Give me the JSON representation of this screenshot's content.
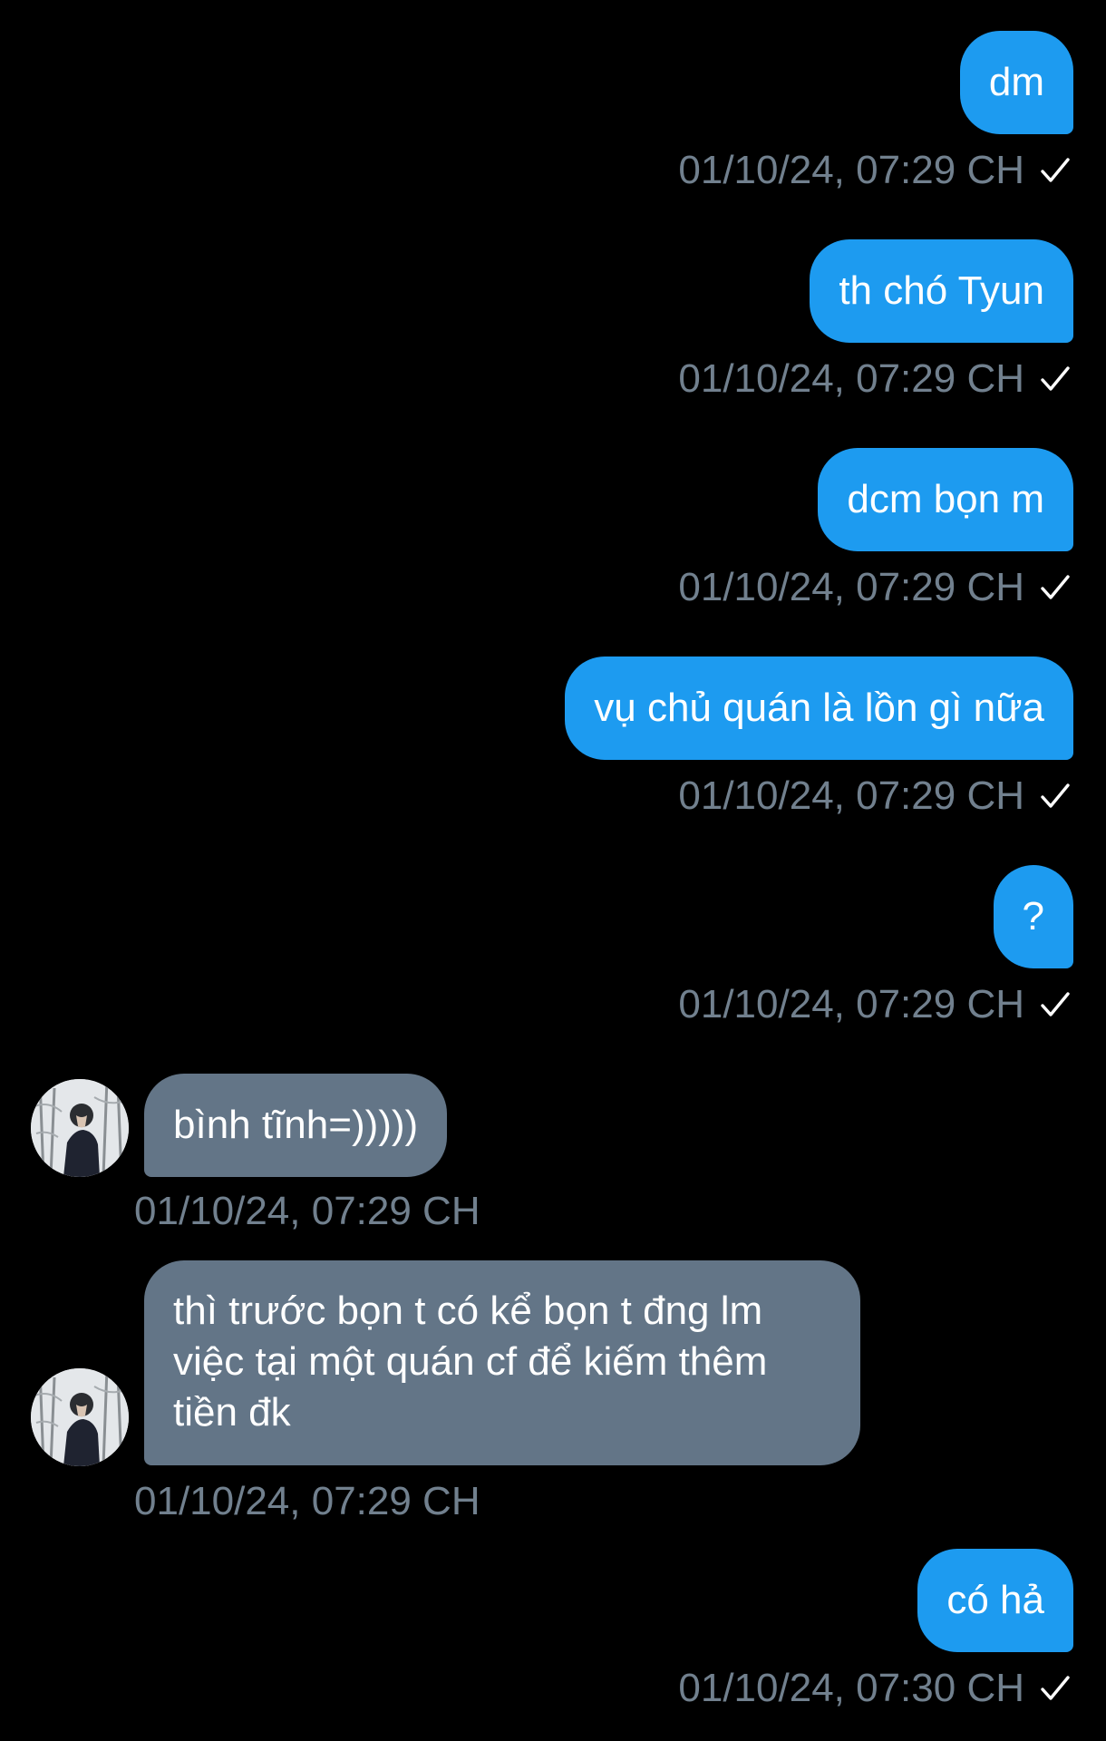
{
  "conversation": {
    "messages": [
      {
        "direction": "outgoing",
        "text": "dm",
        "timestamp": "01/10/24, 07:29 CH",
        "read_receipt": "check-icon"
      },
      {
        "direction": "outgoing",
        "text": "th chó Tyun",
        "timestamp": "01/10/24, 07:29 CH",
        "read_receipt": "check-icon"
      },
      {
        "direction": "outgoing",
        "text": "dcm bọn m",
        "timestamp": "01/10/24, 07:29 CH",
        "read_receipt": "check-icon"
      },
      {
        "direction": "outgoing",
        "text": "vụ chủ quán là lồn gì nữa",
        "timestamp": "01/10/24, 07:29 CH",
        "read_receipt": "check-icon"
      },
      {
        "direction": "outgoing",
        "text": "?",
        "timestamp": "01/10/24, 07:29 CH",
        "read_receipt": "check-icon"
      },
      {
        "direction": "incoming",
        "text": "bình tĩnh=)))))",
        "timestamp": "01/10/24, 07:29 CH"
      },
      {
        "direction": "incoming",
        "text": "thì trước bọn t có kể bọn t đng lm việc tại một quán cf để kiếm thêm tiền đk",
        "timestamp": "01/10/24, 07:29 CH"
      },
      {
        "direction": "outgoing",
        "text": "có hả",
        "timestamp": "01/10/24, 07:30 CH",
        "read_receipt": "check-icon"
      }
    ]
  },
  "colors": {
    "background": "#000000",
    "outgoing_bubble": "#1d9bf0",
    "incoming_bubble": "#637587",
    "timestamp": "#71808e",
    "text": "#ffffff"
  }
}
